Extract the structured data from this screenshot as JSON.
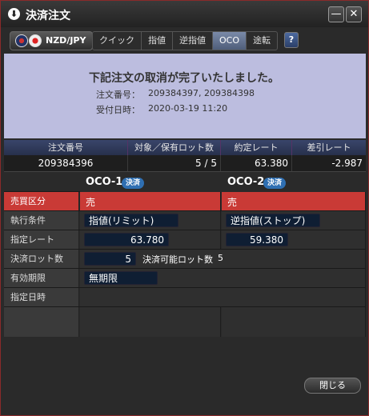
{
  "window": {
    "title": "決済注文",
    "minimize": "—",
    "close": "✕",
    "app_icon": "download-circle-icon"
  },
  "toolbar": {
    "pair": "NZD/JPY",
    "tabs": [
      "クイック",
      "指値",
      "逆指値",
      "OCO",
      "途転"
    ],
    "active_tab": "OCO",
    "help": "?"
  },
  "message": {
    "headline": "下記注文の取消が完了いたしました。",
    "order_no_label": "注文番号：",
    "order_no_value": "209384397, 209384398",
    "received_label": "受付日時：",
    "received_value": "2020-03-19 11:20"
  },
  "grid": {
    "headers": [
      "注文番号",
      "対象／保有ロット数",
      "約定レート",
      "差引レート"
    ],
    "values": [
      "209384396",
      "5 / 5",
      "63.380",
      "-2.987"
    ]
  },
  "oco": {
    "oco1_title": "OCO-1",
    "oco2_title": "OCO-2",
    "badge": "決済",
    "labels": {
      "side": "売買区分",
      "condition": "執行条件",
      "rate": "指定レート",
      "lots": "決済ロット数",
      "expiry": "有効期限",
      "datetime": "指定日時"
    },
    "oco1": {
      "side": "売",
      "condition": "指値(リミット)",
      "rate": "63.780"
    },
    "oco2": {
      "side": "売",
      "condition": "逆指値(ストップ)",
      "rate": "59.380"
    },
    "lots_value": "5",
    "lots_available_label": "決済可能ロット数",
    "lots_available_value": "5",
    "expiry_value": "無期限"
  },
  "footer": {
    "close_label": "閉じる"
  },
  "colors": {
    "sell_red": "#c93a36",
    "header_navy": "#2e3858",
    "message_bg": "#bcbddf"
  }
}
